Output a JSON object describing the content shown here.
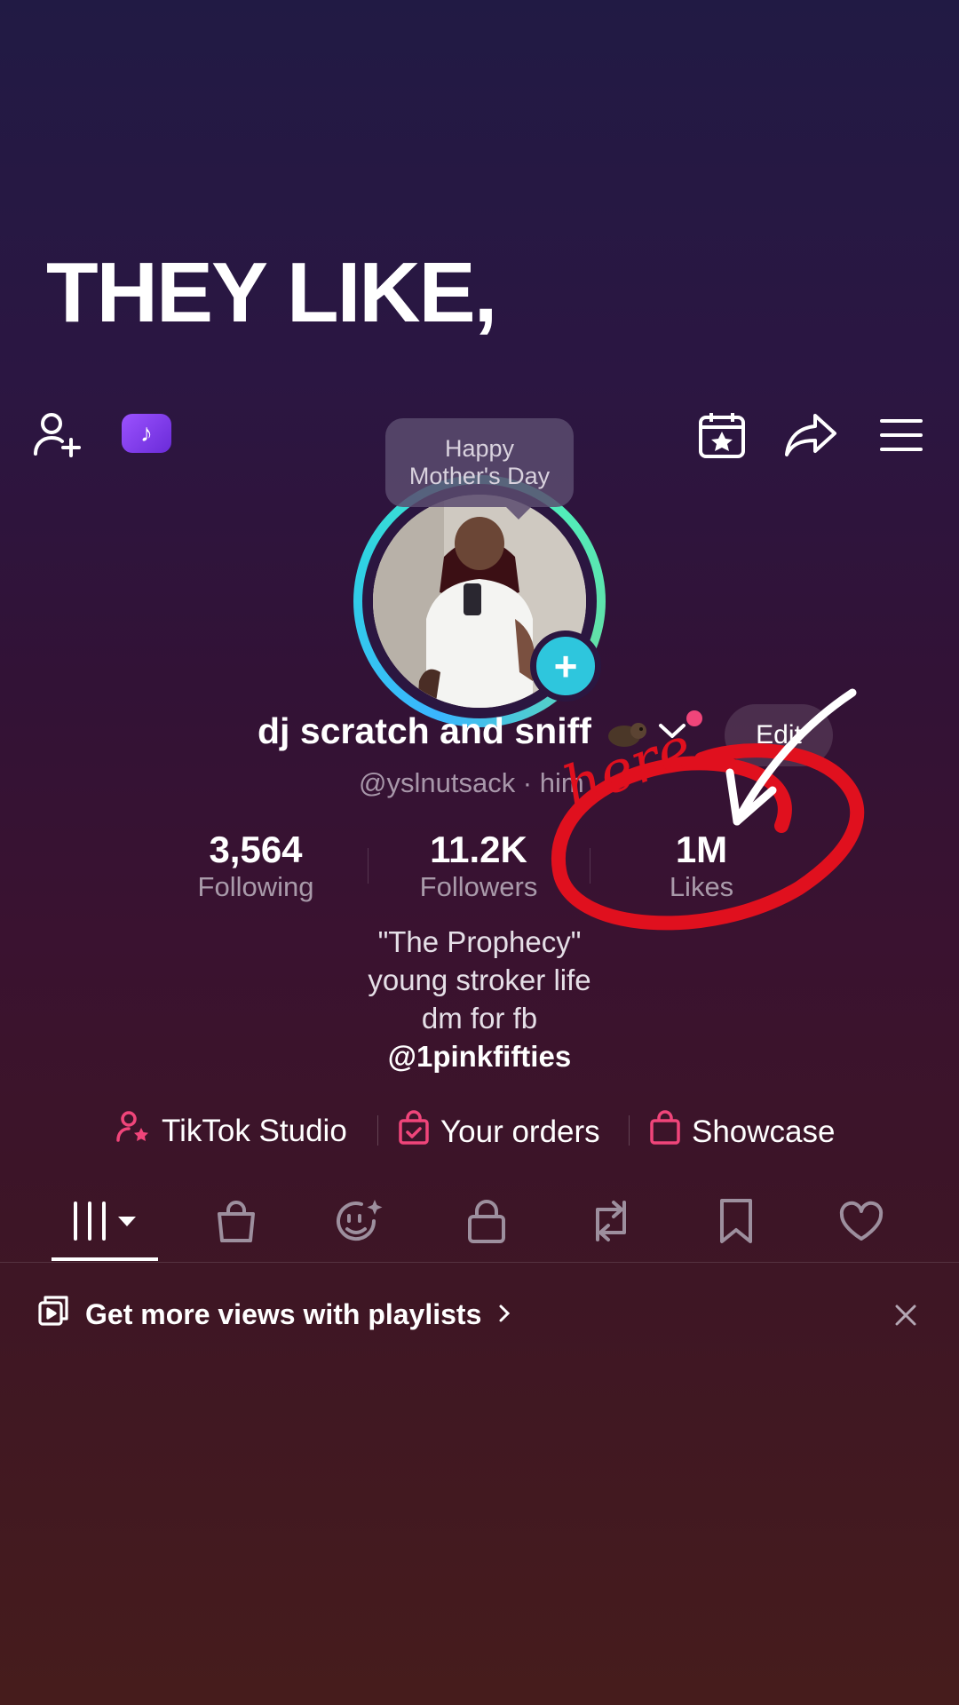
{
  "caption": "THEY LIKE,",
  "header": {
    "bubble_line1": "Happy",
    "bubble_line2": "Mother's Day"
  },
  "profile": {
    "display_name": "dj scratch and sniff",
    "edit_label": "Edit",
    "handle": "@yslnutsack · him"
  },
  "stats": [
    {
      "value": "3,564",
      "label": "Following"
    },
    {
      "value": "11.2K",
      "label": "Followers"
    },
    {
      "value": "1M",
      "label": "Likes"
    }
  ],
  "bio": {
    "line1": "\"The Prophecy\"",
    "line2": "young stroker life",
    "line3": "dm for fb",
    "link": "@1pinkfifties"
  },
  "quick_links": [
    {
      "label": "TikTok Studio"
    },
    {
      "label": "Your orders"
    },
    {
      "label": "Showcase"
    }
  ],
  "promo": {
    "text": "Get more views with playlists"
  },
  "annotation": {
    "text": "here"
  },
  "colors": {
    "accent_pink": "#f0457a",
    "ring_teal": "#2fd2e2",
    "annotation_red": "#e0101e"
  }
}
